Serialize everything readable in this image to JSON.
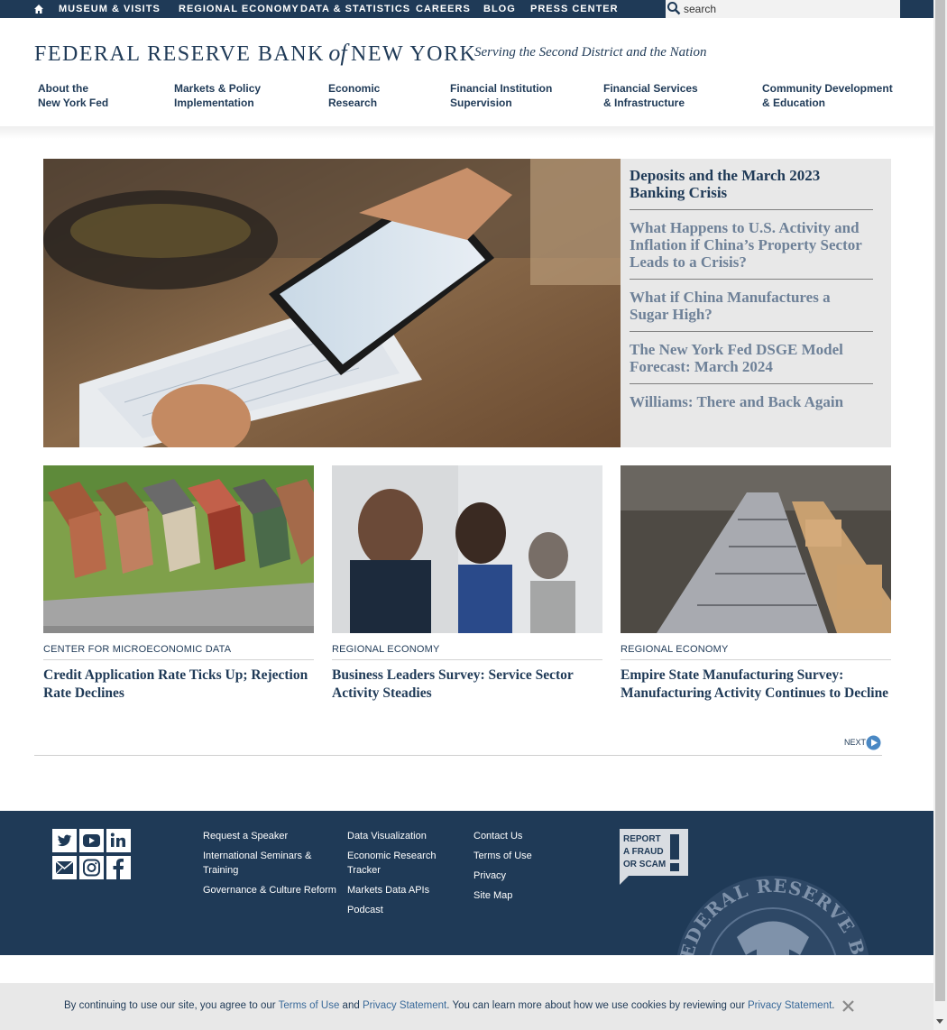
{
  "topbar": {
    "home_icon": "home-icon",
    "links": [
      "MUSEUM & VISITS",
      "REGIONAL ECONOMY",
      "DATA & STATISTICS",
      "CAREERS",
      "BLOG",
      "PRESS CENTER"
    ],
    "search_placeholder": "search",
    "search_icon": "search-icon"
  },
  "logo": {
    "name_part1": "FEDERAL RESERVE BANK",
    "name_of": "of",
    "name_part2": "NEW YORK",
    "tagline": "Serving the Second District and the Nation"
  },
  "nav": [
    {
      "line1": "About the",
      "line2": "New York Fed"
    },
    {
      "line1": "Markets & Policy",
      "line2": "Implementation"
    },
    {
      "line1": "Economic",
      "line2": "Research"
    },
    {
      "line1": "Financial Institution",
      "line2": "Supervision"
    },
    {
      "line1": "Financial Services",
      "line2": "& Infrastructure"
    },
    {
      "line1": "Community Development",
      "line2": "& Education"
    }
  ],
  "hero": {
    "image_alt": "Hand holding a check and a smartphone",
    "items": [
      "Deposits and the March 2023 Banking Crisis",
      "What Happens to U.S. Activity and Inflation if China’s Property Sector Leads to a Crisis?",
      "What if China Manufactures a Sugar High?",
      "The New York Fed DSGE Model Forecast: March 2024",
      "Williams: There and Back Again"
    ]
  },
  "cards": [
    {
      "kicker": "CENTER FOR MICROECONOMIC DATA",
      "title": "Credit Application Rate Ticks Up; Rejection Rate Declines",
      "image": "row-houses-aerial"
    },
    {
      "kicker": "REGIONAL ECONOMY",
      "title": "Business Leaders Survey: Service Sector Activity Steadies",
      "image": "office-workers"
    },
    {
      "kicker": "REGIONAL ECONOMY",
      "title": "Empire State Manufacturing Survey: Manufacturing Activity Continues to Decline",
      "image": "conveyor-boxes"
    }
  ],
  "next_label": "NEXT",
  "footer": {
    "social": [
      "twitter-icon",
      "youtube-icon",
      "linkedin-icon",
      "email-icon",
      "instagram-icon",
      "facebook-icon"
    ],
    "col1": [
      "Request a Speaker",
      "International Seminars & Training",
      "Governance & Culture Reform"
    ],
    "col2": [
      "Data Visualization",
      "Economic Research Tracker",
      "Markets Data APIs",
      "Podcast"
    ],
    "col3": [
      "Contact Us",
      "Terms of Use",
      "Privacy",
      "Site Map"
    ],
    "fraud_lines": [
      "REPORT",
      "A FRAUD",
      "OR SCAM"
    ],
    "seal_text": "FEDERAL RESERVE BANK OF NEW YORK"
  },
  "cookie": {
    "prefix": "By continuing to use our site, you agree to our ",
    "terms": "Terms of Use",
    "and": " and ",
    "privacy1": "Privacy Statement",
    "middle": ". You can learn more about how we use cookies by reviewing our ",
    "privacy2": "Privacy Statement",
    "suffix": "."
  },
  "colors": {
    "navy": "#1f3a57",
    "light_panel": "#e8e8e8",
    "muted_link": "#6e8198"
  }
}
